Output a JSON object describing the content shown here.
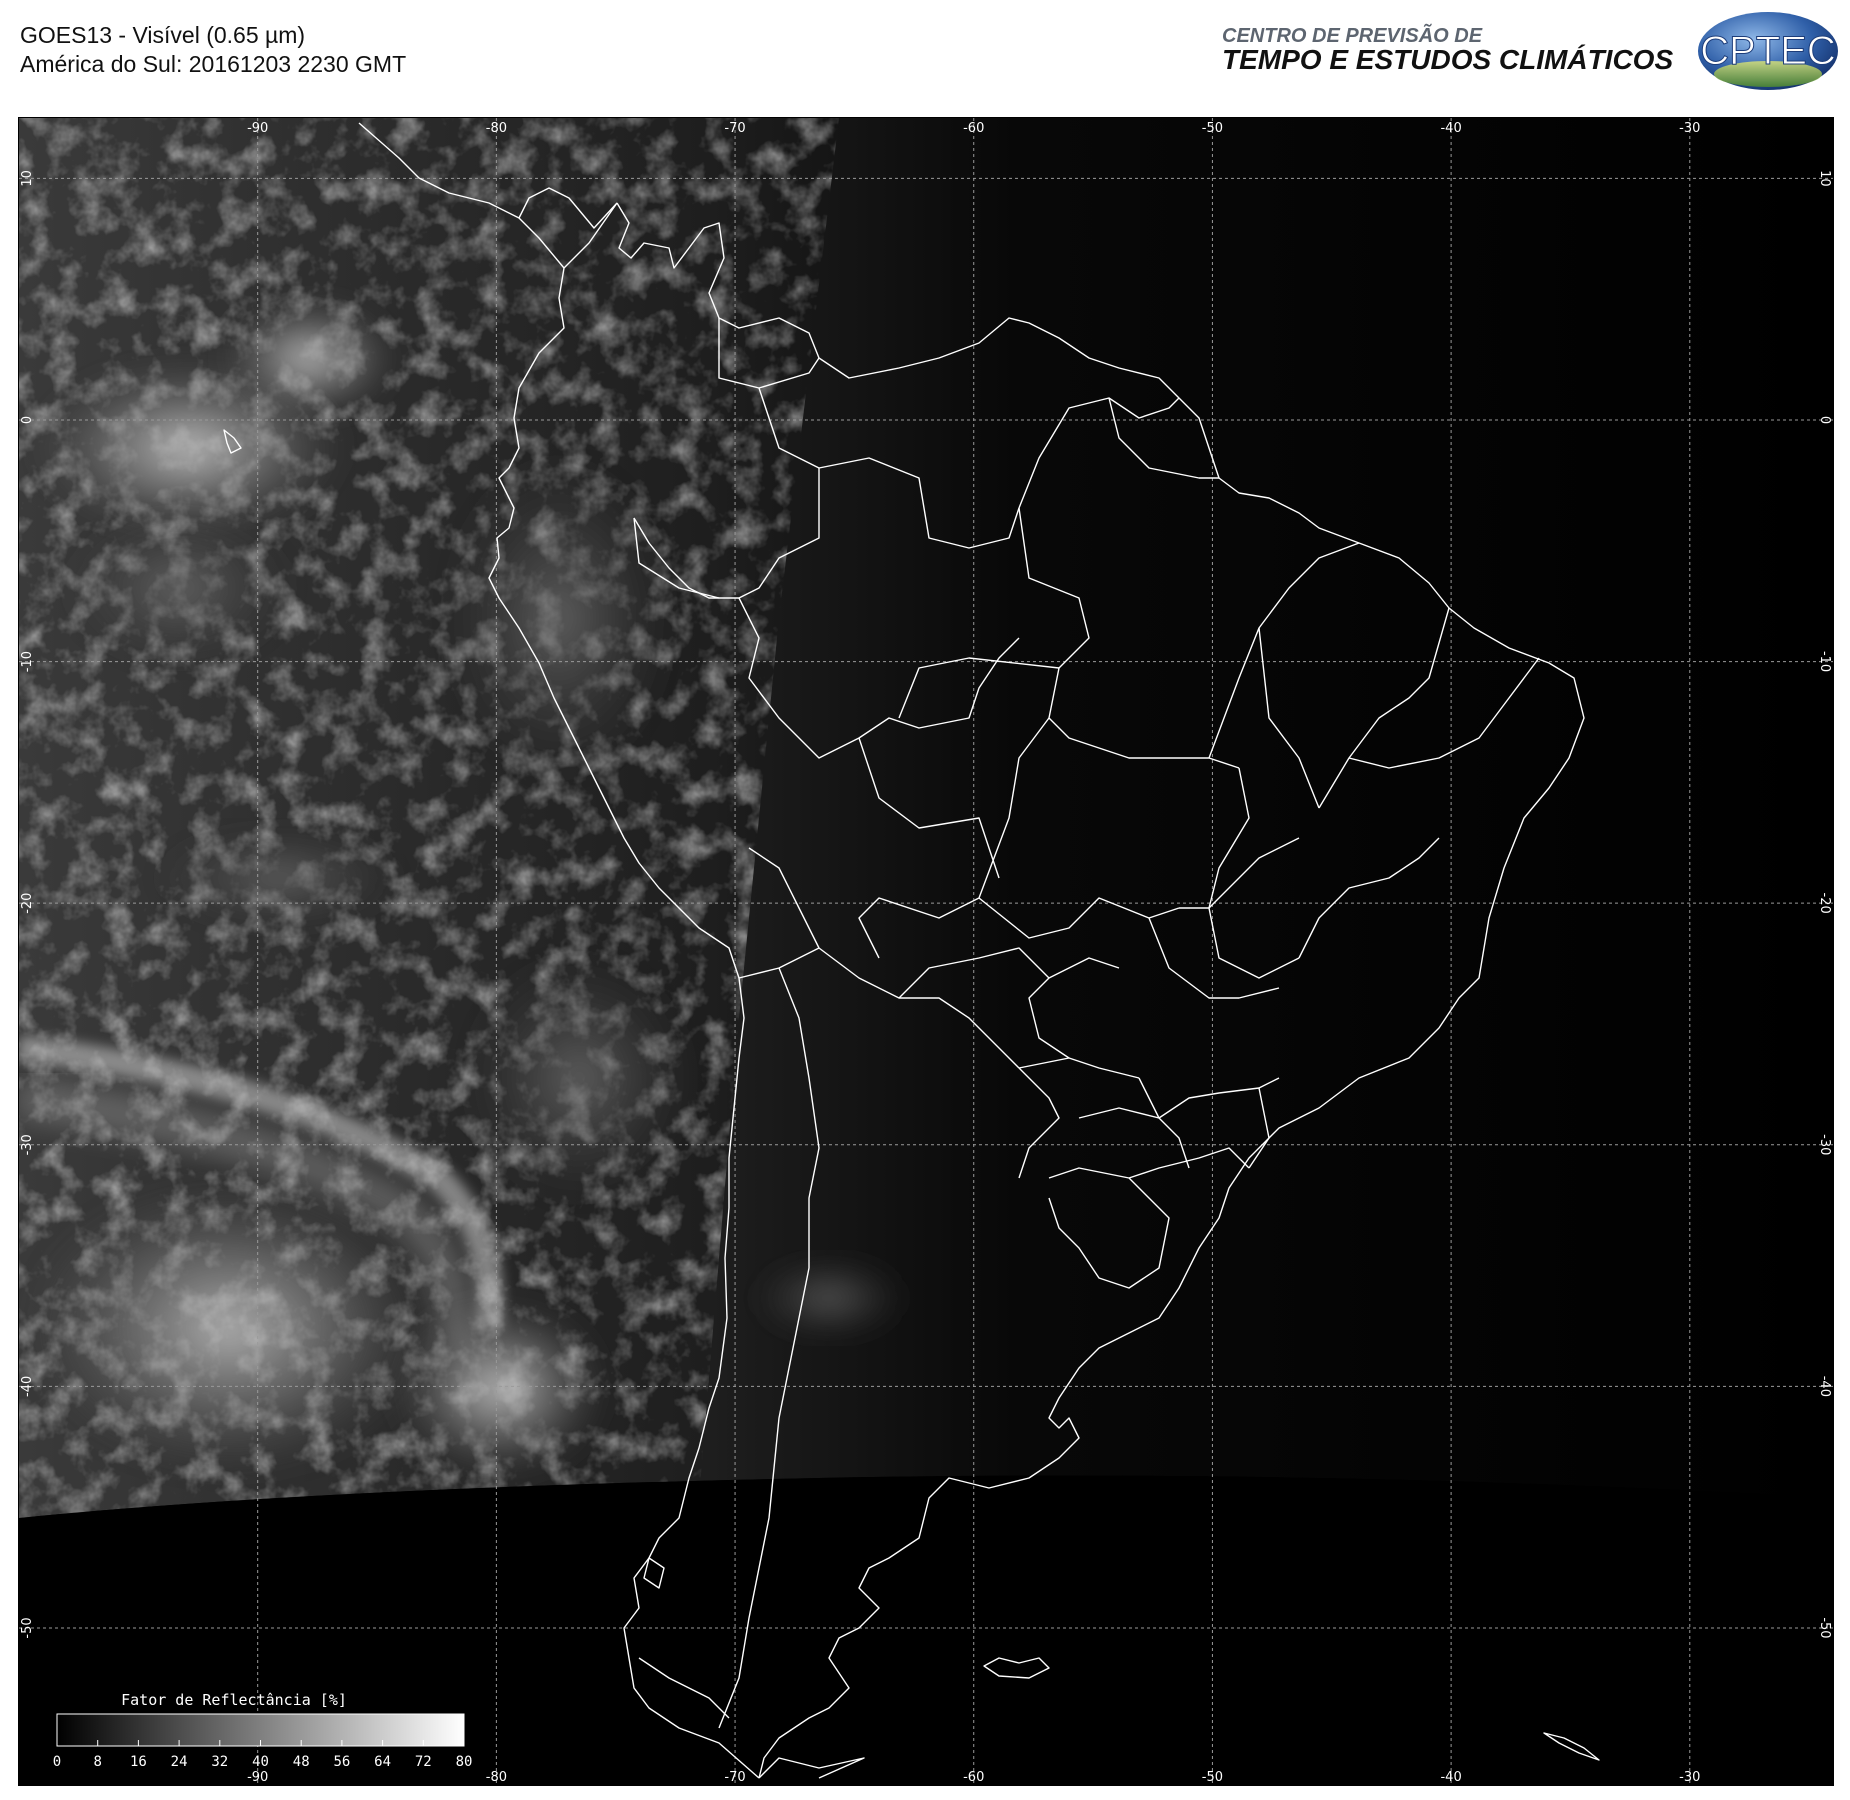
{
  "header": {
    "title_line1": "GOES13 - Visível (0.65 µm)",
    "title_line2": "América do Sul: 20161203 2230 GMT",
    "org_line1": "CENTRO DE PREVISÃO DE",
    "org_line2": "TEMPO E ESTUDOS CLIMÁTICOS",
    "logo_text": "CPTEC"
  },
  "map": {
    "longitudes": [
      -90,
      -80,
      -70,
      -60,
      -50,
      -40,
      -30
    ],
    "latitudes": [
      10,
      0,
      -10,
      -20,
      -30,
      -40,
      -50
    ],
    "lon_range": [
      -100,
      -24
    ],
    "lat_range": [
      12.5,
      -56.5
    ],
    "grid": true,
    "colors": {
      "background": "#000000",
      "borders": "#ffffff",
      "grid": "#9a9a9a"
    }
  },
  "colorbar": {
    "title": "Fator de Reflectância [%]",
    "ticks": [
      "0",
      "8",
      "16",
      "24",
      "32",
      "40",
      "48",
      "56",
      "64",
      "72",
      "80"
    ],
    "min": 0,
    "max": 80
  }
}
